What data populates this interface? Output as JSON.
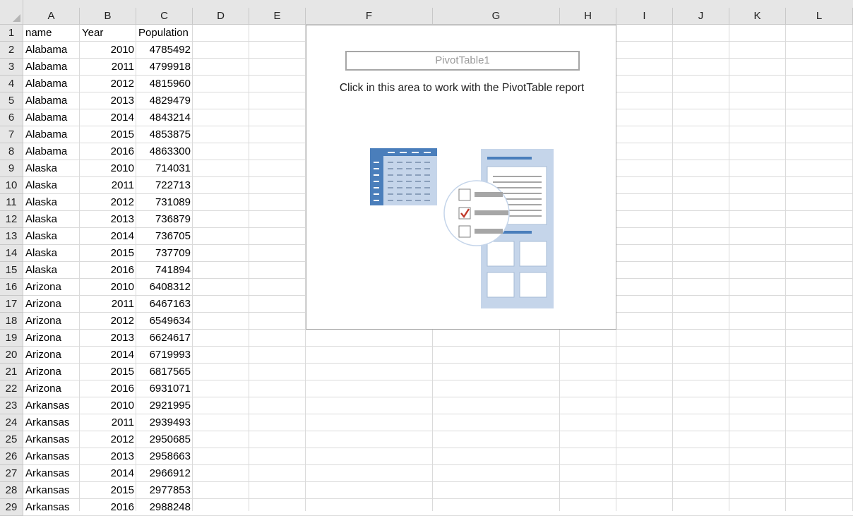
{
  "columns": [
    "A",
    "B",
    "C",
    "D",
    "E",
    "F",
    "G",
    "H",
    "I",
    "J",
    "K",
    "L"
  ],
  "rows": [
    {
      "num": "1",
      "name": "name",
      "year": "Year",
      "pop": "Population"
    },
    {
      "num": "2",
      "name": "Alabama",
      "year": "2010",
      "pop": "4785492"
    },
    {
      "num": "3",
      "name": "Alabama",
      "year": "2011",
      "pop": "4799918"
    },
    {
      "num": "4",
      "name": "Alabama",
      "year": "2012",
      "pop": "4815960"
    },
    {
      "num": "5",
      "name": "Alabama",
      "year": "2013",
      "pop": "4829479"
    },
    {
      "num": "6",
      "name": "Alabama",
      "year": "2014",
      "pop": "4843214"
    },
    {
      "num": "7",
      "name": "Alabama",
      "year": "2015",
      "pop": "4853875"
    },
    {
      "num": "8",
      "name": "Alabama",
      "year": "2016",
      "pop": "4863300"
    },
    {
      "num": "9",
      "name": "Alaska",
      "year": "2010",
      "pop": "714031"
    },
    {
      "num": "10",
      "name": "Alaska",
      "year": "2011",
      "pop": "722713"
    },
    {
      "num": "11",
      "name": "Alaska",
      "year": "2012",
      "pop": "731089"
    },
    {
      "num": "12",
      "name": "Alaska",
      "year": "2013",
      "pop": "736879"
    },
    {
      "num": "13",
      "name": "Alaska",
      "year": "2014",
      "pop": "736705"
    },
    {
      "num": "14",
      "name": "Alaska",
      "year": "2015",
      "pop": "737709"
    },
    {
      "num": "15",
      "name": "Alaska",
      "year": "2016",
      "pop": "741894"
    },
    {
      "num": "16",
      "name": "Arizona",
      "year": "2010",
      "pop": "6408312"
    },
    {
      "num": "17",
      "name": "Arizona",
      "year": "2011",
      "pop": "6467163"
    },
    {
      "num": "18",
      "name": "Arizona",
      "year": "2012",
      "pop": "6549634"
    },
    {
      "num": "19",
      "name": "Arizona",
      "year": "2013",
      "pop": "6624617"
    },
    {
      "num": "20",
      "name": "Arizona",
      "year": "2014",
      "pop": "6719993"
    },
    {
      "num": "21",
      "name": "Arizona",
      "year": "2015",
      "pop": "6817565"
    },
    {
      "num": "22",
      "name": "Arizona",
      "year": "2016",
      "pop": "6931071"
    },
    {
      "num": "23",
      "name": "Arkansas",
      "year": "2010",
      "pop": "2921995"
    },
    {
      "num": "24",
      "name": "Arkansas",
      "year": "2011",
      "pop": "2939493"
    },
    {
      "num": "25",
      "name": "Arkansas",
      "year": "2012",
      "pop": "2950685"
    },
    {
      "num": "26",
      "name": "Arkansas",
      "year": "2013",
      "pop": "2958663"
    },
    {
      "num": "27",
      "name": "Arkansas",
      "year": "2014",
      "pop": "2966912"
    },
    {
      "num": "28",
      "name": "Arkansas",
      "year": "2015",
      "pop": "2977853"
    },
    {
      "num": "29",
      "name": "Arkansas",
      "year": "2016",
      "pop": "2988248"
    }
  ],
  "pivot": {
    "name": "PivotTable1",
    "message": "Click in this area to work with the PivotTable report"
  },
  "colors": {
    "header_bg": "#e6e6e6",
    "gridline": "#dadada",
    "pivot_art_blue": "#4a7ebb",
    "pivot_art_light": "#c5d5ea",
    "check_red": "#c0392b"
  },
  "icons": [
    "select-all-triangle-icon",
    "pivot-table-illustration-icon",
    "checkmark-icon"
  ]
}
